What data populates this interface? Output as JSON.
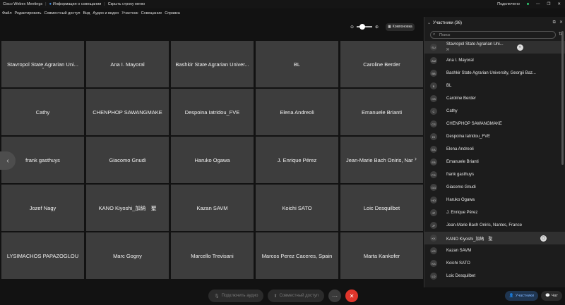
{
  "titlebar": {
    "app": "Cisco Webex Meetings",
    "info": "Информация о совещании",
    "hide_menu": "Скрыть строку меню",
    "connected": "Подключено",
    "minimize": "—",
    "restore": "❐",
    "close": "✕"
  },
  "menu": [
    "Файл",
    "Редактировать",
    "Совместный доступ",
    "Вид",
    "Аудио и видео",
    "Участник",
    "Совещание",
    "Справка"
  ],
  "toolbar": {
    "layout_label": "Компоновка"
  },
  "tiles": [
    "Stavropol State Agrarian Uni...",
    "Ana I. Mayoral",
    "Bashkir State Agrarian Univer...",
    "BL",
    "Caroline Berder",
    "Cathy",
    "CHENPHOP SAWANGMAKE",
    "Despoina Iatridou_FVE",
    "Elena Andreoli",
    "Emanuele Brianti",
    "frank gasthuys",
    "Giacomo Gnudi",
    "Haruko Ogawa",
    "J. Enrique Pérez",
    "Jean-Marie Bach Oniris, Nar",
    "Jozef Nagy",
    "KANO Kiyoshi_加納　聖",
    "Kazan SAVM",
    "Koichi SATO",
    "Loic Desquilbet",
    "LYSIMACHOS PAPAZOGLOU",
    "Marc Gogny",
    "Marcello Trevisani",
    "Marcos Perez Caceres, Spain",
    "Marta Kankofer"
  ],
  "bottom": {
    "audio": "Подключить аудио",
    "share": "Совместный доступ",
    "more": "⋯",
    "leave": "✕"
  },
  "panel": {
    "title": "Участники (36)",
    "search_placeholder": "Поиск",
    "me_label": "Я",
    "participants": [
      {
        "initials": "SU",
        "name": "Stavropol State Agrarian Uni..."
      },
      {
        "initials": "AM",
        "name": "Ana I. Mayoral"
      },
      {
        "initials": "BB",
        "name": "Bashkir State Agrarian University, Georgii Baz..."
      },
      {
        "initials": "B",
        "name": "BL"
      },
      {
        "initials": "CB",
        "name": "Caroline Berder"
      },
      {
        "initials": "C",
        "name": "Cathy"
      },
      {
        "initials": "CS",
        "name": "CHENPHOP SAWANGMAKE"
      },
      {
        "initials": "DI",
        "name": "Despoina Iatridou_FVE"
      },
      {
        "initials": "EA",
        "name": "Elena Andreoli"
      },
      {
        "initials": "EB",
        "name": "Emanuele Brianti"
      },
      {
        "initials": "FG",
        "name": "frank gasthuys"
      },
      {
        "initials": "GG",
        "name": "Giacomo Gnudi"
      },
      {
        "initials": "HO",
        "name": "Haruko Ogawa"
      },
      {
        "initials": "JP",
        "name": "J. Enrique Pérez"
      },
      {
        "initials": "JF",
        "name": "Jean-Marie Bach Oniris, Nantes, France"
      },
      {
        "initials": "KK",
        "name": "KANO Kiyoshi_加納　聖"
      },
      {
        "initials": "KS",
        "name": "Kazan SAVM"
      },
      {
        "initials": "KS",
        "name": "Koichi SATO"
      },
      {
        "initials": "LD",
        "name": "Loic Desquilbet"
      }
    ],
    "participants_btn": "Участники",
    "chat_btn": "Чат"
  }
}
